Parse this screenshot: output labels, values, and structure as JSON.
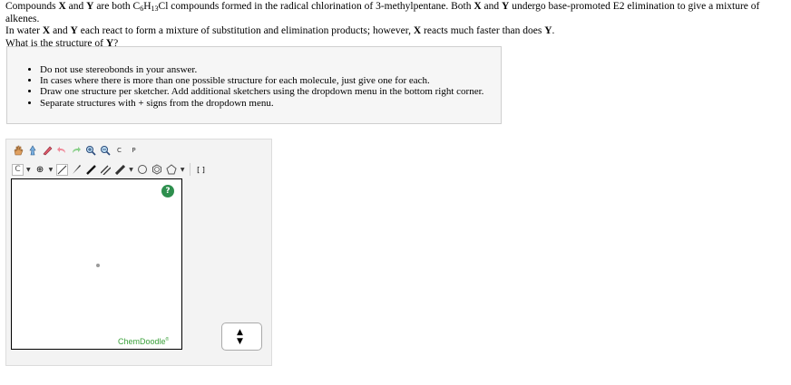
{
  "question": {
    "line1": {
      "p1": "Compounds ",
      "x": "X",
      "p2": " and ",
      "y": "Y",
      "p3": " are both C",
      "sub1": "6",
      "p4": "H",
      "sub2": "13",
      "p5": "Cl compounds formed in the radical chlorination of 3-methylpentane. Both ",
      "x2": "X",
      "p6": " and ",
      "y2": "Y",
      "p7": " undergo base-promoted E2 elimination to give a mixture of alkenes."
    },
    "line2": {
      "p1": "In water ",
      "x": "X",
      "p2": " and ",
      "y": "Y",
      "p3": " each react to form a mixture of substitution and elimination products; however, ",
      "x2": "X",
      "p4": " reacts much faster than does ",
      "y2": "Y",
      "p5": "."
    },
    "line3": {
      "p1": "What is the structure of ",
      "y": "Y",
      "p2": "?"
    }
  },
  "instructions": [
    "Do not use stereobonds in your answer.",
    "In cases where there is more than one possible structure for each molecule, just give one for each.",
    "Draw one structure per sketcher. Add additional sketchers using the dropdown menu in the bottom right corner.",
    "Separate structures with + signs from the dropdown menu."
  ],
  "sketcher": {
    "element_label": "C",
    "charge_label": "⊕",
    "clean_label": "C",
    "periodic_label": "P",
    "bracket_label": "[ ]",
    "help_label": "?",
    "brand": "ChemDoodle",
    "brand_mark": "®",
    "spinner_up": "▲",
    "spinner_down": "▼",
    "colors": {
      "help": "#2e8f4e",
      "brand": "#3aa03a"
    }
  }
}
